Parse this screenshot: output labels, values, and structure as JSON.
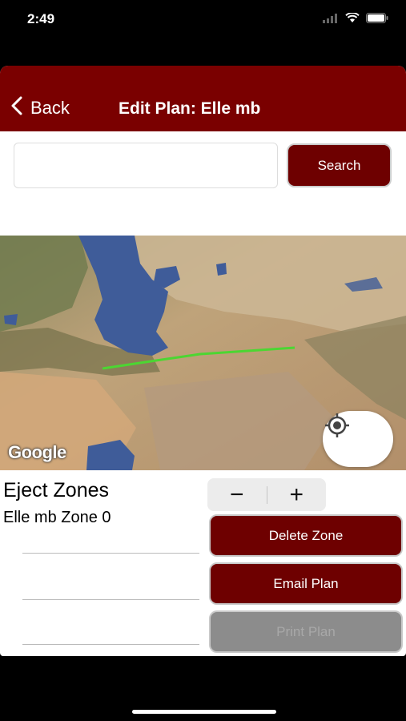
{
  "status_bar": {
    "time": "2:49"
  },
  "nav": {
    "back_label": "Back",
    "title": "Edit Plan: Elle mb"
  },
  "search": {
    "value": "",
    "placeholder": "",
    "button_label": "Search"
  },
  "map": {
    "attribution": "Google",
    "route_color": "#4cd632"
  },
  "zones": {
    "title": "Eject Zones",
    "items": [
      {
        "label": "Elle mb Zone 0"
      }
    ]
  },
  "stepper": {
    "minus_label": "−",
    "plus_label": "+"
  },
  "actions": {
    "delete_label": "Delete Zone",
    "email_label": "Email Plan",
    "third_label": "Print Plan"
  },
  "colors": {
    "brand": "#7a0000",
    "button": "#6e0000",
    "disabled": "#8c8c8c"
  }
}
